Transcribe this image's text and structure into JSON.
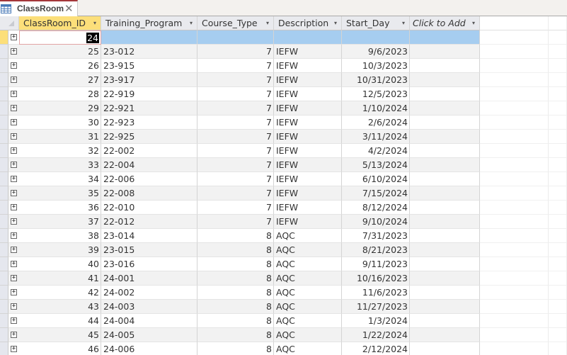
{
  "tab": {
    "title": "ClassRoom",
    "icon": "table-icon",
    "close_icon": "close-icon"
  },
  "columns": [
    {
      "label": "ClassRoom_ID",
      "dropdown": "▾"
    },
    {
      "label": "Training_Program",
      "dropdown": "▾"
    },
    {
      "label": "Course_Type",
      "dropdown": "▾"
    },
    {
      "label": "Description",
      "dropdown": "▾"
    },
    {
      "label": "Start_Day",
      "dropdown": "▾"
    },
    {
      "label": "Click to Add",
      "dropdown": "▾"
    }
  ],
  "new_row": {
    "id_value": "24"
  },
  "expand_glyph": "+",
  "rows": [
    {
      "id": "25",
      "program": "23-012",
      "type": "7",
      "desc": "IEFW",
      "start": "9/6/2023"
    },
    {
      "id": "26",
      "program": "23-915",
      "type": "7",
      "desc": "IEFW",
      "start": "10/3/2023"
    },
    {
      "id": "27",
      "program": "23-917",
      "type": "7",
      "desc": "IEFW",
      "start": "10/31/2023"
    },
    {
      "id": "28",
      "program": "22-919",
      "type": "7",
      "desc": "IEFW",
      "start": "12/5/2023"
    },
    {
      "id": "29",
      "program": "22-921",
      "type": "7",
      "desc": "IEFW",
      "start": "1/10/2024"
    },
    {
      "id": "30",
      "program": "22-923",
      "type": "7",
      "desc": "IEFW",
      "start": "2/6/2024"
    },
    {
      "id": "31",
      "program": "22-925",
      "type": "7",
      "desc": "IEFW",
      "start": "3/11/2024"
    },
    {
      "id": "32",
      "program": "22-002",
      "type": "7",
      "desc": "IEFW",
      "start": "4/2/2024"
    },
    {
      "id": "33",
      "program": "22-004",
      "type": "7",
      "desc": "IEFW",
      "start": "5/13/2024"
    },
    {
      "id": "34",
      "program": "22-006",
      "type": "7",
      "desc": "IEFW",
      "start": "6/10/2024"
    },
    {
      "id": "35",
      "program": "22-008",
      "type": "7",
      "desc": "IEFW",
      "start": "7/15/2024"
    },
    {
      "id": "36",
      "program": "22-010",
      "type": "7",
      "desc": "IEFW",
      "start": "8/12/2024"
    },
    {
      "id": "37",
      "program": "22-012",
      "type": "7",
      "desc": "IEFW",
      "start": "9/10/2024"
    },
    {
      "id": "38",
      "program": "23-014",
      "type": "8",
      "desc": "AQC",
      "start": "7/31/2023"
    },
    {
      "id": "39",
      "program": "23-015",
      "type": "8",
      "desc": "AQC",
      "start": "8/21/2023"
    },
    {
      "id": "40",
      "program": "23-016",
      "type": "8",
      "desc": "AQC",
      "start": "9/11/2023"
    },
    {
      "id": "41",
      "program": "24-001",
      "type": "8",
      "desc": "AQC",
      "start": "10/16/2023"
    },
    {
      "id": "42",
      "program": "24-002",
      "type": "8",
      "desc": "AQC",
      "start": "11/6/2023"
    },
    {
      "id": "43",
      "program": "24-003",
      "type": "8",
      "desc": "AQC",
      "start": "11/27/2023"
    },
    {
      "id": "44",
      "program": "24-004",
      "type": "8",
      "desc": "AQC",
      "start": "1/3/2024"
    },
    {
      "id": "45",
      "program": "24-005",
      "type": "8",
      "desc": "AQC",
      "start": "1/22/2024"
    },
    {
      "id": "46",
      "program": "24-006",
      "type": "8",
      "desc": "AQC",
      "start": "2/12/2024"
    }
  ]
}
